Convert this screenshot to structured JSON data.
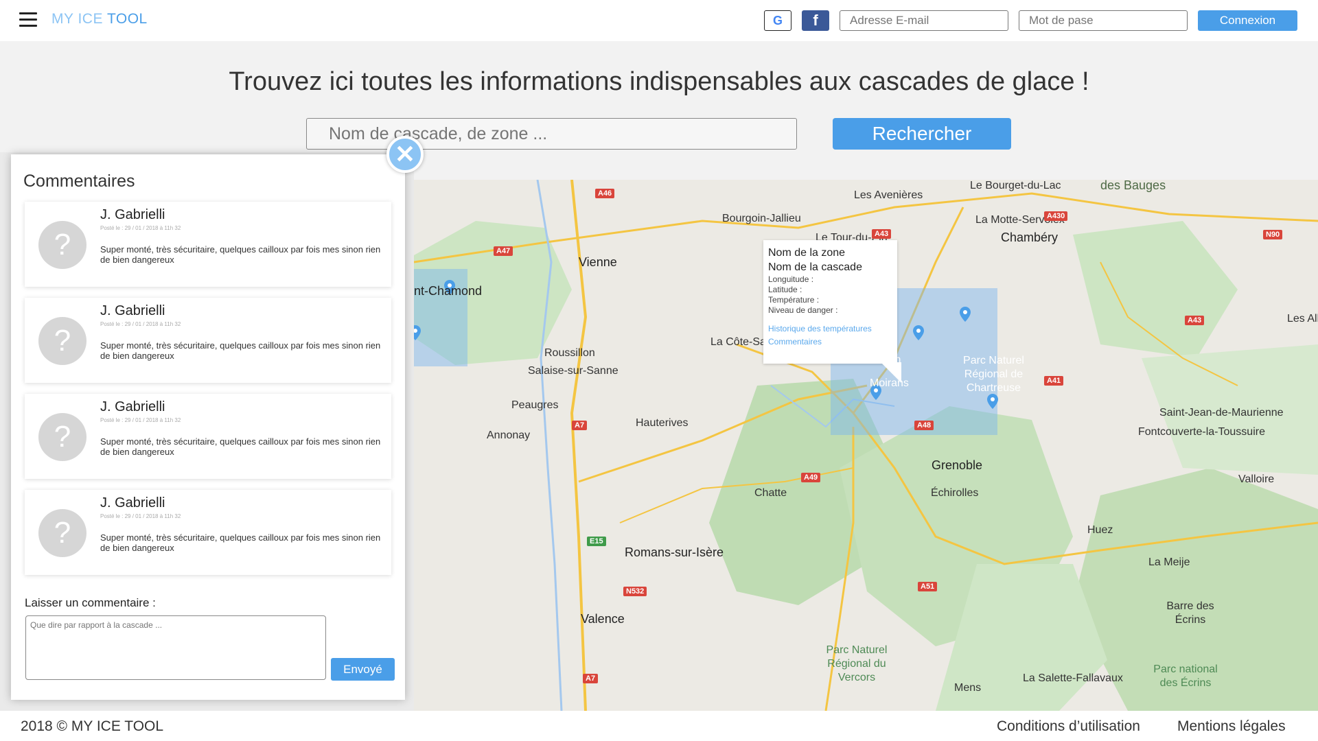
{
  "header": {
    "logo_my": "MY ICE",
    "logo_tool": "TOOL",
    "email_placeholder": "Adresse E-mail",
    "password_placeholder": "Mot de pase",
    "login_label": "Connexion",
    "facebook_letter": "f",
    "google_letter": "G"
  },
  "hero": {
    "title": "Trouvez ici toutes les informations indispensables aux cascades de glace !",
    "search_placeholder": "Nom de cascade, de zone ...",
    "search_button": "Rechercher"
  },
  "map": {
    "places": [
      "Le Bourget-du-Lac",
      "des Bauges",
      "Les Avenières",
      "Bourgoin-Jallieu",
      "La Motte-Servolex",
      "Le Tour-du-Pin",
      "Chambéry",
      "Vienne",
      "int-Chamond",
      "Roussillon",
      "Salaise-sur-Sanne",
      "La Côte-Sa",
      "Peaugres",
      "Annonay",
      "Hauterives",
      "Moirans",
      "Voiron",
      "Grenoble",
      "Échirolles",
      "Chatte",
      "Romans-sur-Isère",
      "Valence",
      "Parc Naturel Régional du Vercors",
      "Parc Naturel Régional de Chartreuse",
      "Saint-Jean-de-Maurienne",
      "Fontcouverte-la-Toussuire",
      "Valloire",
      "Huez",
      "La Meije",
      "Barre des Écrins",
      "Parc national des Écrins",
      "La Salette-Fallavaux",
      "Mens",
      "Les All"
    ],
    "roads": [
      "A46",
      "A47",
      "A43",
      "A430",
      "N90",
      "A43",
      "A41",
      "A48",
      "A7",
      "A49",
      "E15",
      "N532",
      "A51",
      "A7"
    ],
    "popup": {
      "zone_name": "Nom de la zone",
      "cascade_name": "Nom de la cascade",
      "longitude": "Longuitude :",
      "latitude": "Latitude :",
      "temperature": "Température :",
      "danger": "Niveau de danger :",
      "history_link": "Historique des températures",
      "comments_link": "Commentaires"
    }
  },
  "comments_panel": {
    "title": "Commentaires",
    "avatar_glyph": "?",
    "close_glyph": "✕",
    "items": [
      {
        "author": "J. Gabrielli",
        "date": "Posté le : 29 / 01 / 2018 à 11h 32",
        "text": "Super monté, très sécuritaire, quelques cailloux par fois mes sinon rien de bien dangereux"
      },
      {
        "author": "J. Gabrielli",
        "date": "Posté le : 29 / 01 / 2018 à 11h 32",
        "text": "Super monté, très sécuritaire, quelques cailloux par fois mes sinon rien de bien dangereux"
      },
      {
        "author": "J. Gabrielli",
        "date": "Posté le : 29 / 01 / 2018 à 11h 32",
        "text": "Super monté, très sécuritaire, quelques cailloux par fois mes sinon rien de bien dangereux"
      },
      {
        "author": "J. Gabrielli",
        "date": "Posté le : 29 / 01 / 2018 à 11h 32",
        "text": "Super monté, très sécuritaire, quelques cailloux par fois mes sinon rien de bien dangereux"
      }
    ],
    "leave_label": "Laisser un commentaire :",
    "textarea_placeholder": "Que dire par rapport à la cascade ...",
    "send_label": "Envoyé"
  },
  "footer": {
    "copyright": "2018 © MY ICE TOOL",
    "terms": "Conditions d’utilisation",
    "legal": "Mentions légales"
  },
  "colors": {
    "accent": "#4a9ee8",
    "accent_light": "#8cc4f4",
    "facebook": "#3b5998",
    "zone_overlay": "#78b4f0"
  }
}
